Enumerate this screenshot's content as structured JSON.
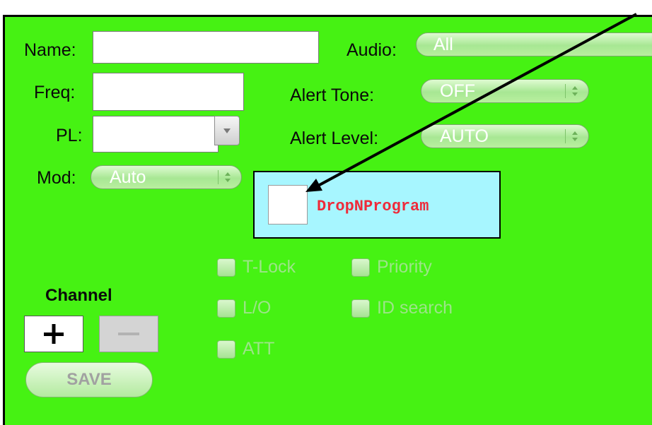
{
  "form": {
    "name_label": "Name:",
    "name_value": "",
    "freq_label": "Freq:",
    "freq_value": "",
    "pl_label": "PL:",
    "pl_value": "",
    "mod_label": "Mod:",
    "mod_value": "Auto",
    "audio_label": "Audio:",
    "audio_value": "All",
    "alert_tone_label": "Alert Tone:",
    "alert_tone_value": "OFF",
    "alert_level_label": "Alert Level:",
    "alert_level_value": "AUTO"
  },
  "drop_target": {
    "label": "DropNProgram"
  },
  "options": {
    "tlock": "T-Lock",
    "priority": "Priority",
    "lo": "L/O",
    "id_search": "ID search",
    "att": "ATT"
  },
  "channel": {
    "label": "Channel",
    "add_label": "+",
    "remove_label": "—",
    "save_label": "SAVE"
  },
  "colors": {
    "panel_background": "#46f213",
    "drop_background": "#a7f6ff",
    "drop_text": "#ee2b3a"
  }
}
